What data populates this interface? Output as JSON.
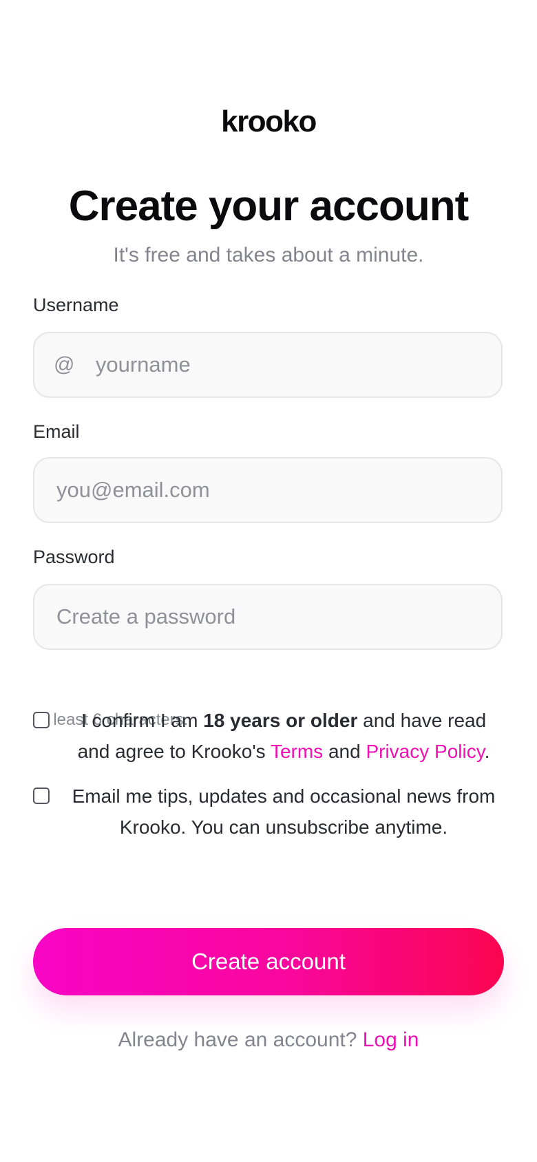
{
  "brand": {
    "name": "krooko"
  },
  "header": {
    "title": "Create your account",
    "subtitle": "It's free and takes about a minute."
  },
  "form": {
    "username": {
      "label": "Username",
      "prefix": "@",
      "placeholder": "yourname",
      "value": ""
    },
    "email": {
      "label": "Email",
      "placeholder": "you@email.com",
      "value": ""
    },
    "password": {
      "label": "Password",
      "placeholder": "Create a password",
      "value": "",
      "hint": "At least 6 characters."
    },
    "age_consent": {
      "checked": false,
      "text_prefix": "I confirm I am ",
      "text_bold": "18 years or older",
      "text_middle": " and have read and agree to Krooko's ",
      "terms_link": "Terms",
      "text_and": " and ",
      "privacy_link": "Privacy Policy",
      "text_end": "."
    },
    "marketing_opt_in": {
      "checked": false,
      "text": "Email me tips, updates and occasional news from Krooko. You can unsubscribe anytime."
    },
    "submit_label": "Create account"
  },
  "footer": {
    "prompt": "Already have an account? ",
    "login_link": "Log in"
  },
  "colors": {
    "accent": "#f00fb3",
    "gradient_start": "#f905c6",
    "gradient_end": "#fb0550",
    "text_primary": "#0b0b0e",
    "text_muted": "#84848f"
  }
}
